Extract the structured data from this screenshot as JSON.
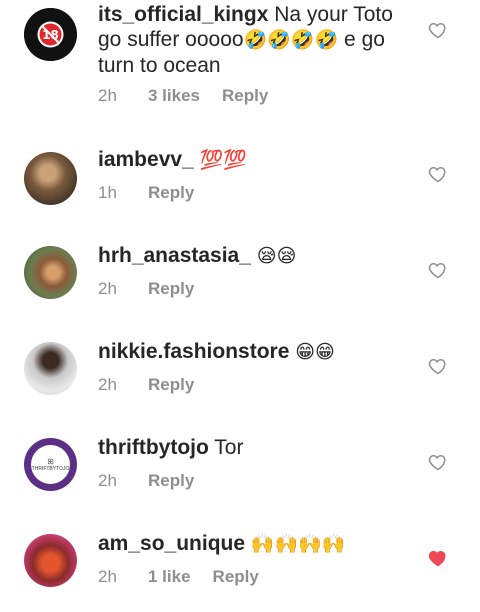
{
  "comments": [
    {
      "username": "its_official_kingx",
      "text_lines": [
        "Na your Toto",
        "go suffer ooooo",
        "turn to ocean"
      ],
      "emoji_line2": "🤣🤣🤣🤣",
      "text_line2_tail": " e go",
      "time": "2h",
      "likes": "3 likes",
      "reply": "Reply",
      "liked": false
    },
    {
      "username": "iambevv_",
      "text": "💯💯",
      "time": "1h",
      "reply": "Reply",
      "liked": false
    },
    {
      "username": "hrh_anastasia_",
      "text": "😪😪",
      "time": "2h",
      "reply": "Reply",
      "liked": false
    },
    {
      "username": "nikkie.fashionstore",
      "text": "😁😁",
      "time": "2h",
      "reply": "Reply",
      "liked": false
    },
    {
      "username": "thriftbytojo",
      "text": "Tor",
      "avatar_text": "THRIFTBYTOJO",
      "time": "2h",
      "reply": "Reply",
      "liked": false
    },
    {
      "username": "am_so_unique",
      "text": "🙌🙌🙌🙌",
      "time": "2h",
      "likes": "1 like",
      "reply": "Reply",
      "liked": true
    }
  ],
  "colors": {
    "text": "#262626",
    "meta": "#8e8e8e",
    "heart_outline": "#8e8e8e",
    "heart_liked": "#ed4956"
  },
  "icons": {
    "heart": "heart-icon",
    "avatar_badge": "18-plus-badge-icon"
  }
}
